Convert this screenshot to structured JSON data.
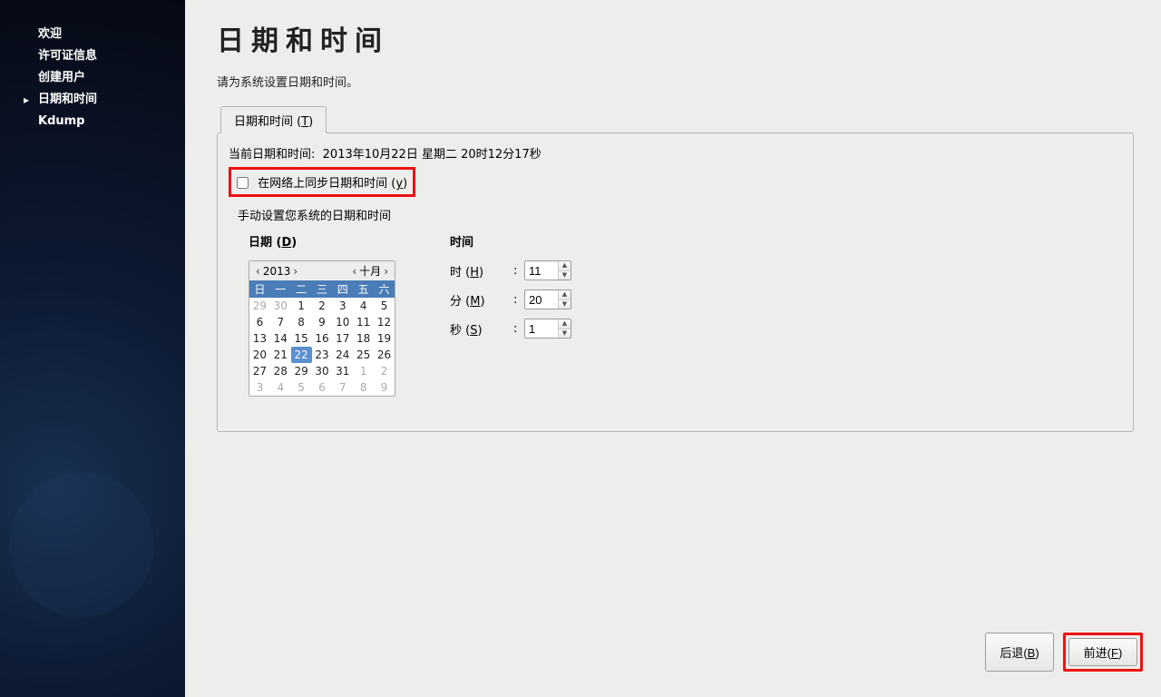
{
  "sidebar": {
    "items": [
      {
        "label": "欢迎"
      },
      {
        "label": "许可证信息"
      },
      {
        "label": "创建用户"
      },
      {
        "label": "日期和时间"
      },
      {
        "label": "Kdump"
      }
    ],
    "active_index": 3
  },
  "page": {
    "title": "日期和时间",
    "subtitle": "请为系统设置日期和时间。"
  },
  "tab": {
    "label_prefix": "日期和时间 (",
    "accel": "T",
    "label_suffix": ")"
  },
  "current_dt": {
    "prefix": "当前日期和时间:",
    "value": "2013年10月22日  星期二  20时12分17秒"
  },
  "ntp": {
    "label_prefix": "在网络上同步日期和时间 (",
    "accel": "y",
    "label_suffix": ")",
    "checked": false
  },
  "manual_hint": "手动设置您系统的日期和时间",
  "date_section": {
    "title_prefix": "日期 (",
    "accel": "D",
    "title_suffix": ")",
    "year": "2013",
    "month": "十月",
    "weekdays": [
      "日",
      "一",
      "二",
      "三",
      "四",
      "五",
      "六"
    ],
    "rows": [
      [
        {
          "d": "29",
          "o": true
        },
        {
          "d": "30",
          "o": true
        },
        {
          "d": "1"
        },
        {
          "d": "2"
        },
        {
          "d": "3"
        },
        {
          "d": "4"
        },
        {
          "d": "5"
        }
      ],
      [
        {
          "d": "6"
        },
        {
          "d": "7"
        },
        {
          "d": "8"
        },
        {
          "d": "9"
        },
        {
          "d": "10"
        },
        {
          "d": "11"
        },
        {
          "d": "12"
        }
      ],
      [
        {
          "d": "13"
        },
        {
          "d": "14"
        },
        {
          "d": "15"
        },
        {
          "d": "16"
        },
        {
          "d": "17"
        },
        {
          "d": "18"
        },
        {
          "d": "19"
        }
      ],
      [
        {
          "d": "20"
        },
        {
          "d": "21"
        },
        {
          "d": "22",
          "sel": true
        },
        {
          "d": "23"
        },
        {
          "d": "24"
        },
        {
          "d": "25"
        },
        {
          "d": "26"
        }
      ],
      [
        {
          "d": "27"
        },
        {
          "d": "28"
        },
        {
          "d": "29"
        },
        {
          "d": "30"
        },
        {
          "d": "31"
        },
        {
          "d": "1",
          "o": true
        },
        {
          "d": "2",
          "o": true
        }
      ],
      [
        {
          "d": "3",
          "o": true
        },
        {
          "d": "4",
          "o": true
        },
        {
          "d": "5",
          "o": true
        },
        {
          "d": "6",
          "o": true
        },
        {
          "d": "7",
          "o": true
        },
        {
          "d": "8",
          "o": true
        },
        {
          "d": "9",
          "o": true
        }
      ]
    ]
  },
  "time_section": {
    "title": "时间",
    "hour_label_prefix": "时 (",
    "hour_accel": "H",
    "minute_label_prefix": "分 (",
    "minute_accel": "M",
    "second_label_prefix": "秒 (",
    "second_accel": "S",
    "label_suffix": ")",
    "colon": ":",
    "hour": "11",
    "minute": "20",
    "second": "1"
  },
  "buttons": {
    "back_prefix": "后退(",
    "back_accel": "B",
    "back_suffix": ")",
    "forward_prefix": "前进(",
    "forward_accel": "F",
    "forward_suffix": ")"
  }
}
